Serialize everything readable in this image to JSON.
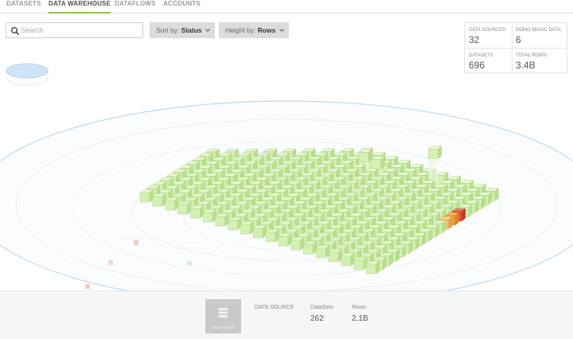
{
  "tabs": [
    {
      "label": "DATASETS",
      "active": false
    },
    {
      "label": "DATA WAREHOUSE",
      "active": true
    },
    {
      "label": "DATAFLOWS",
      "active": false
    },
    {
      "label": "ACCOUNTS",
      "active": false
    }
  ],
  "search": {
    "placeholder": "Search",
    "value": ""
  },
  "sort": {
    "label": "Sort by:",
    "value": "Status"
  },
  "height": {
    "label": "Height by:",
    "value": "Rows"
  },
  "stats": {
    "data_sources": {
      "label": "DATA SOURCES",
      "value": "32"
    },
    "domo_magic": {
      "label": "DOMO MAGIC DATA",
      "value": "6"
    },
    "datasets": {
      "label": "DATASETS",
      "value": "696"
    },
    "total_rows": {
      "label": "TOTAL ROWS",
      "value": "3.4B"
    }
  },
  "footer": {
    "thumb_label": "Data Providers",
    "source_label": "DATA SOURCE",
    "datasets_label": "DataSets",
    "datasets_value": "262",
    "rows_label": "Rows",
    "rows_value": "2.1B"
  },
  "colors": {
    "accent": "#8bc34a",
    "cube_face": "#d6f0b4",
    "cube_top": "#e8f8d2",
    "cube_side": "#b9e08e",
    "alert_red": "#e0503a",
    "alert_orange": "#f29a36",
    "ring": "#c7dff0"
  }
}
